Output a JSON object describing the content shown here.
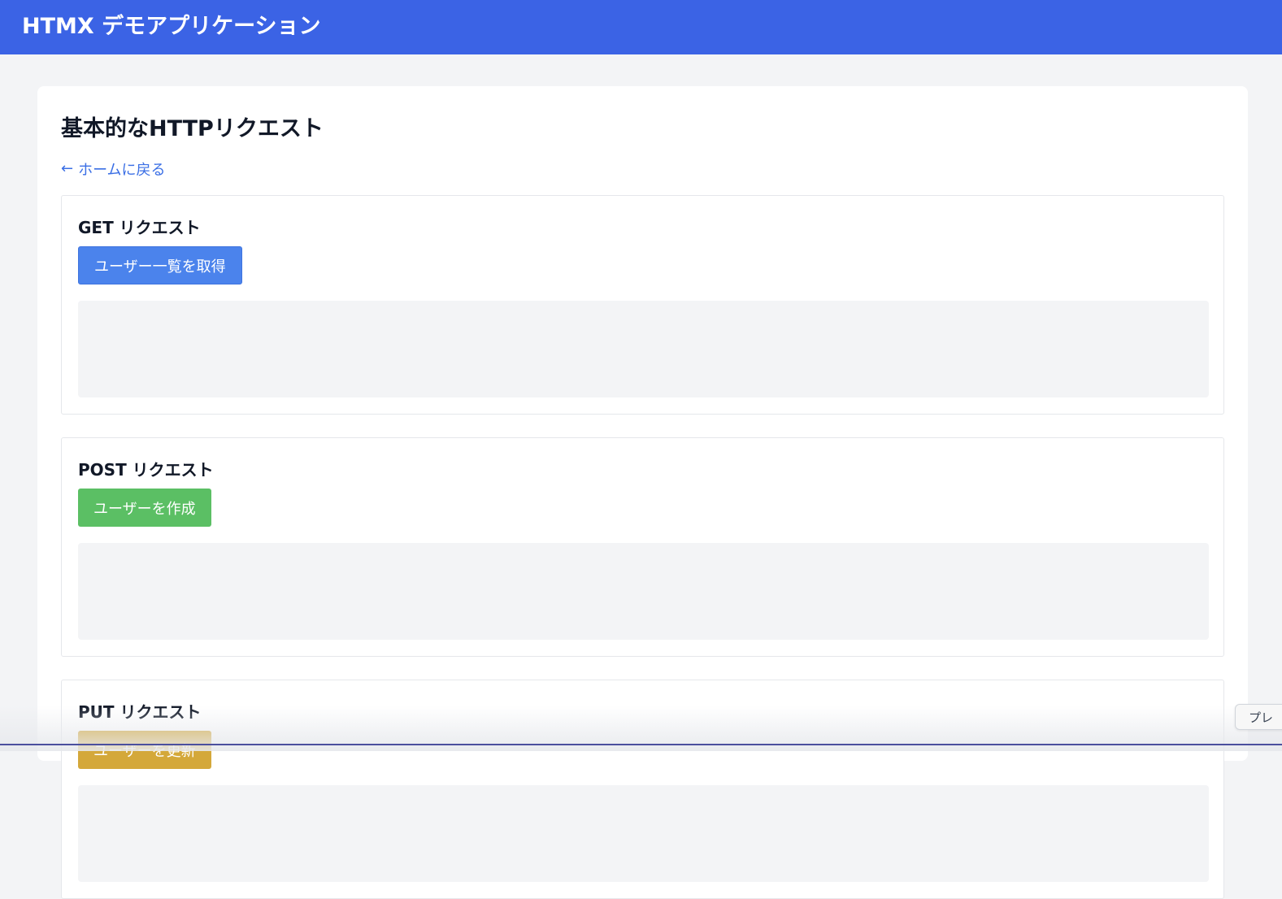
{
  "header": {
    "app_title": "HTMX デモアプリケーション"
  },
  "page": {
    "title": "基本的なHTTPリクエスト",
    "back_link": "ホームに戻る",
    "back_arrow": "←"
  },
  "sections": [
    {
      "title": "GET リクエスト",
      "button_label": "ユーザー一覧を取得",
      "button_color": "#4b83ec",
      "result": ""
    },
    {
      "title": "POST リクエスト",
      "button_label": "ユーザーを作成",
      "button_color": "#5bbf64",
      "result": ""
    },
    {
      "title": "PUT リクエスト",
      "button_label": "ユーザーを更新",
      "button_color": "#d4a83a",
      "result": ""
    }
  ],
  "side_tab": {
    "label": "プレ"
  },
  "colors": {
    "header_bg": "#3b63e5",
    "link": "#3b6fe5",
    "page_bg": "#f3f4f6"
  }
}
